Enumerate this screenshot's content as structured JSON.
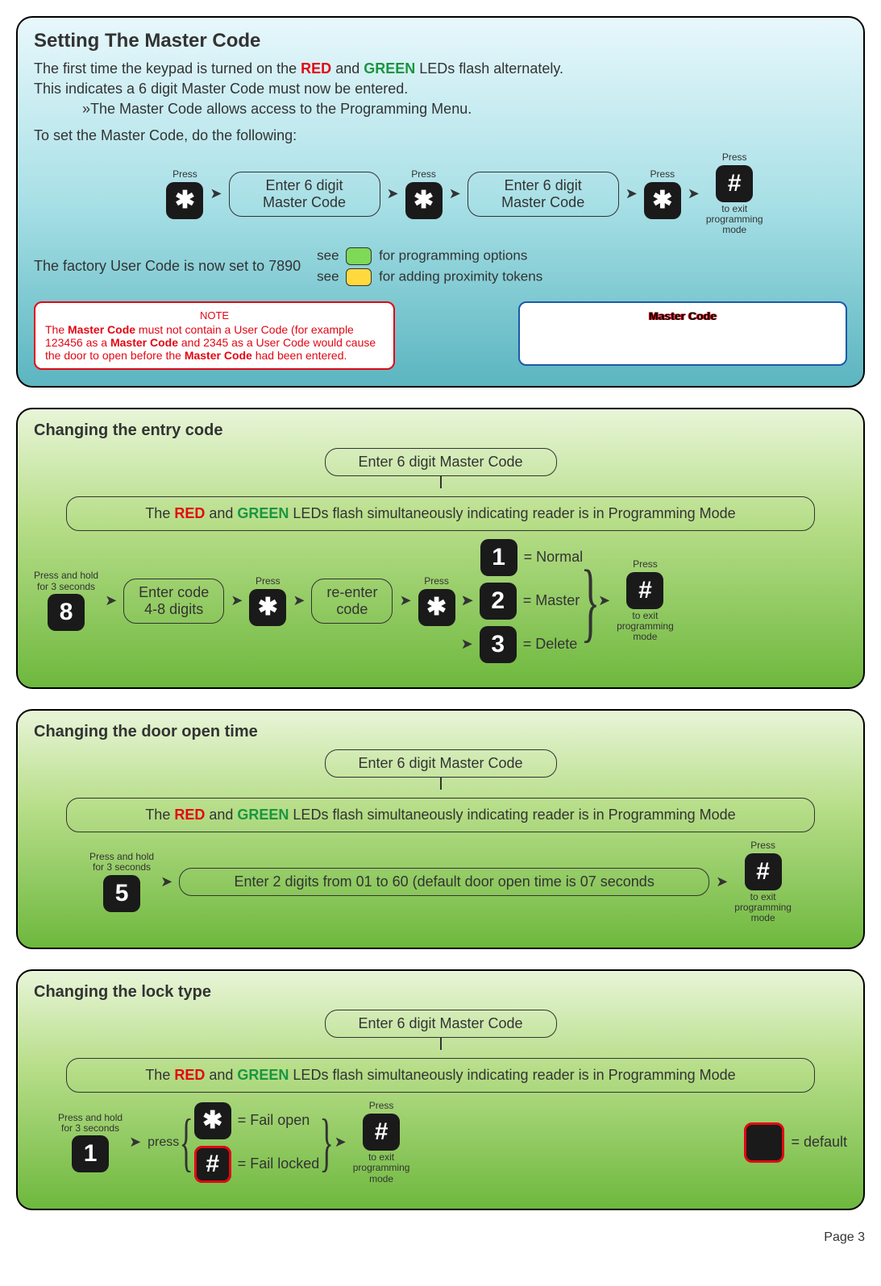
{
  "page_number": "Page 3",
  "section1": {
    "title": "Setting The Master Code",
    "intro1_a": "The first time the keypad is turned on the ",
    "intro1_red": "RED",
    "intro1_b": " and ",
    "intro1_green": "GREEN",
    "intro1_c": " LEDs flash alternately.",
    "intro2": "This indicates a 6 digit Master Code must now be entered.",
    "intro3": "»The Master Code allows access to the Programming Menu.",
    "intro4": "To set the Master Code, do the following:",
    "press": "Press",
    "enter6": "Enter 6 digit\nMaster Code",
    "hash_exit": "to exit\nprogramming\nmode",
    "factory": "The factory User Code is now set to 7890",
    "see1": "for programming options",
    "see2": "for adding proximity tokens",
    "see": "see",
    "note_title": "NOTE",
    "note_body_a": "The ",
    "note_body_b": "Master Code",
    "note_body_c": " must not contain a User Code (for example 123456 as a ",
    "note_body_d": "Master Code",
    "note_body_e": " and 2345 as a User Code would cause the door to open before the ",
    "note_body_f": "Master Code",
    "note_body_g": " had been entered.",
    "master_box_title": "Master Code"
  },
  "banner_a": "The ",
  "banner_red": "RED",
  "banner_b": " and ",
  "banner_green": "GREEN",
  "banner_c": " LEDs flash simultaneously indicating reader is in Programming Mode",
  "enter_master_pill": "Enter 6 digit Master Code",
  "hold3": "Press and hold\nfor 3 seconds",
  "exit_text": "to exit\nprogramming\nmode",
  "press": "Press",
  "section2": {
    "title": "Changing the entry code",
    "enter_code": "Enter code\n4-8 digits",
    "reenter": "re-enter\ncode",
    "opt1": "= Normal",
    "opt2": "= Master",
    "opt3": "= Delete",
    "key8": "8",
    "key1": "1",
    "key2": "2",
    "key3": "3"
  },
  "section3": {
    "title": "Changing the door open time",
    "enter_digits": "Enter 2 digits from 01 to 60 (default door open time is 07 seconds",
    "key5": "5"
  },
  "section4": {
    "title": "Changing the lock type",
    "key1": "1",
    "press_word": "press",
    "fail_open": "= Fail open",
    "fail_locked": "= Fail locked",
    "default": "= default"
  },
  "keys": {
    "star": "✱",
    "hash": "#"
  }
}
